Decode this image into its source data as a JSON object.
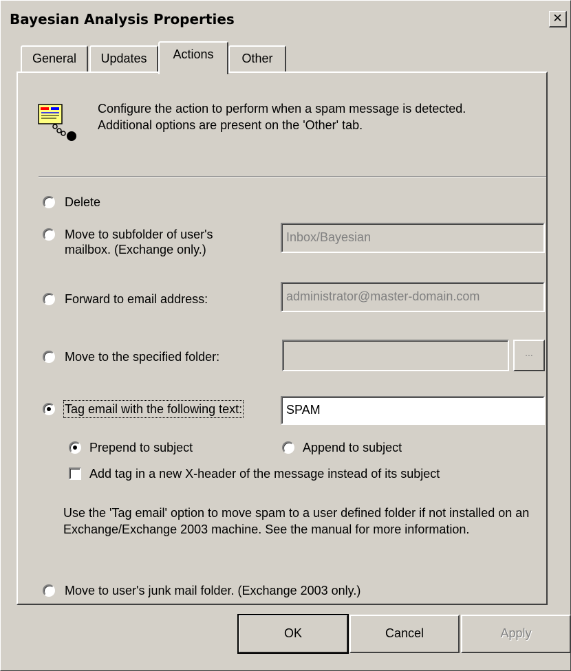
{
  "window": {
    "title": "Bayesian Analysis Properties",
    "close_glyph": "✕"
  },
  "tabs": [
    {
      "label": "General",
      "active": false
    },
    {
      "label": "Updates",
      "active": false
    },
    {
      "label": "Actions",
      "active": true
    },
    {
      "label": "Other",
      "active": false
    }
  ],
  "info": {
    "icon": "message-chain-icon",
    "line1": "Configure the action to perform when a spam message is detected.",
    "line2": "Additional options are present on the 'Other' tab."
  },
  "options": {
    "delete": {
      "label": "Delete",
      "checked": false
    },
    "move_subfolder": {
      "label_line1": "Move to subfolder of user's",
      "label_line2": "mailbox. (Exchange only.)",
      "value": "Inbox/Bayesian",
      "checked": false
    },
    "forward": {
      "label": "Forward to email address:",
      "value": "administrator@master-domain.com",
      "checked": false
    },
    "move_folder": {
      "label": "Move to the specified folder:",
      "value": "",
      "browse_label": "...",
      "checked": false
    },
    "tag": {
      "label": "Tag email with the following text:",
      "value": "SPAM",
      "checked": true
    },
    "junk": {
      "label": "Move to user's junk mail folder. (Exchange 2003 only.)",
      "checked": false
    }
  },
  "tag_position": {
    "prepend": {
      "label": "Prepend to subject",
      "checked": true
    },
    "append": {
      "label": "Append to subject",
      "checked": false
    }
  },
  "xheader": {
    "label": "Add tag in a new X-header of the message instead of its subject",
    "checked": false
  },
  "help": {
    "text": "Use the 'Tag email' option to move spam to a user defined folder if not installed on an Exchange/Exchange 2003 machine. See the manual for more information."
  },
  "buttons": {
    "ok": "OK",
    "cancel": "Cancel",
    "apply": "Apply"
  }
}
